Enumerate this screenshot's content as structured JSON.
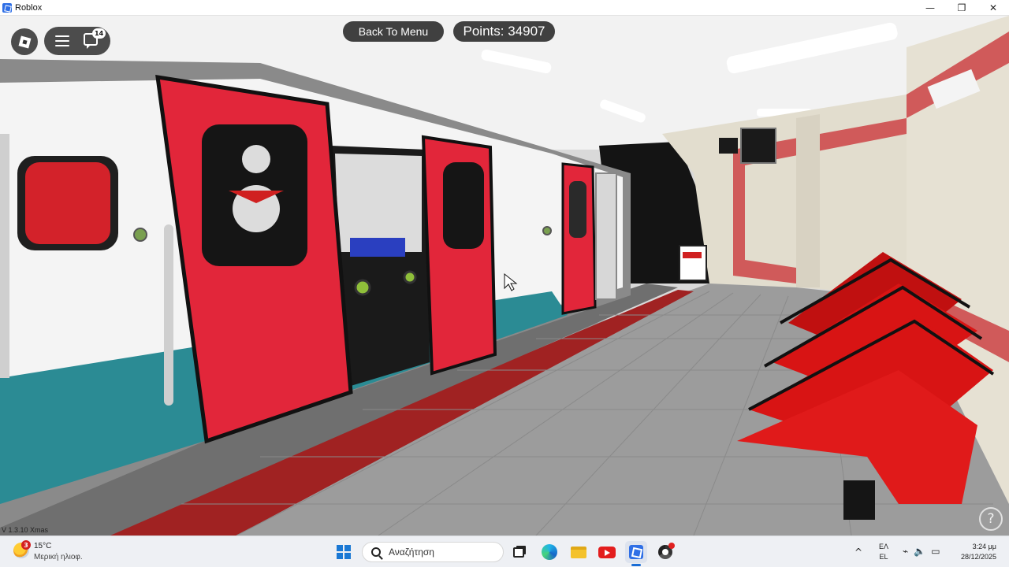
{
  "window": {
    "title": "Roblox",
    "minimize_glyph": "—",
    "maximize_glyph": "❐",
    "close_glyph": "✕"
  },
  "hud": {
    "chat_badge": "14",
    "back_button_label": "Back To Menu",
    "points_label": "Points: 34907",
    "version": "V 1.3.10 Xmas",
    "help_glyph": "?"
  },
  "scene": {
    "colors": {
      "door_red": "#e2263a",
      "seat_red": "#d81414",
      "platform_floor": "#9c9c9c",
      "platform_edge_red": "#a02222",
      "wall_tile": "#e2ddce",
      "wall_stripe": "#d05a5a",
      "train_interior_floor": "#2b8b94"
    }
  },
  "taskbar": {
    "weather": {
      "badge": "3",
      "temperature": "15°C",
      "description": "Μερική ηλιοφ."
    },
    "search_placeholder": "Αναζήτηση",
    "apps": [
      "task-view",
      "edge",
      "file-explorer",
      "youtube",
      "roblox",
      "chrome"
    ],
    "tray": {
      "chevron": "^",
      "lang_top": "ΕΛ",
      "lang_bottom": "EL",
      "time": "3:24 μμ",
      "date": "28/12/2025"
    }
  }
}
